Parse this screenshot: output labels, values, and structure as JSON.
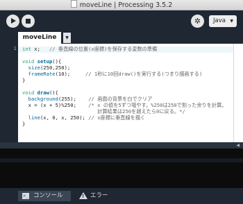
{
  "window": {
    "title": "moveLine | Processing 3.5.2"
  },
  "toolbar": {
    "run_icon": "play-icon",
    "stop_icon": "stop-icon",
    "debug_icon": "butterfly-icon",
    "mode_label": "Java"
  },
  "tabs": [
    {
      "label": "moveLine"
    }
  ],
  "editor": {
    "lines": [
      "int x;   // 垂直線の位置(x座標)を保存する変数の準備",
      "",
      "void setup(){",
      "  size(250,250);",
      "  frameRate(10);     // 1秒に10回draw()を実行する(つまり描画する)",
      "}",
      "",
      "void draw(){",
      "  background(255);    // 画面の背景を白でクリア",
      "  x = (x + 5)%250;    /* x の値を5ずつ増やす。%250は250で割った余りを計算。",
      "                         計算結果は250を越えたら0に戻る。*/",
      "  line(x, 0, x, 250); // x座標に垂直線を描く",
      "}"
    ]
  },
  "footer": {
    "console_label": "コンソール",
    "errors_label": "エラー"
  },
  "colors": {
    "toolbar": "#1e2732",
    "keyword": "#33997e",
    "function": "#006699",
    "comment": "#666666"
  }
}
